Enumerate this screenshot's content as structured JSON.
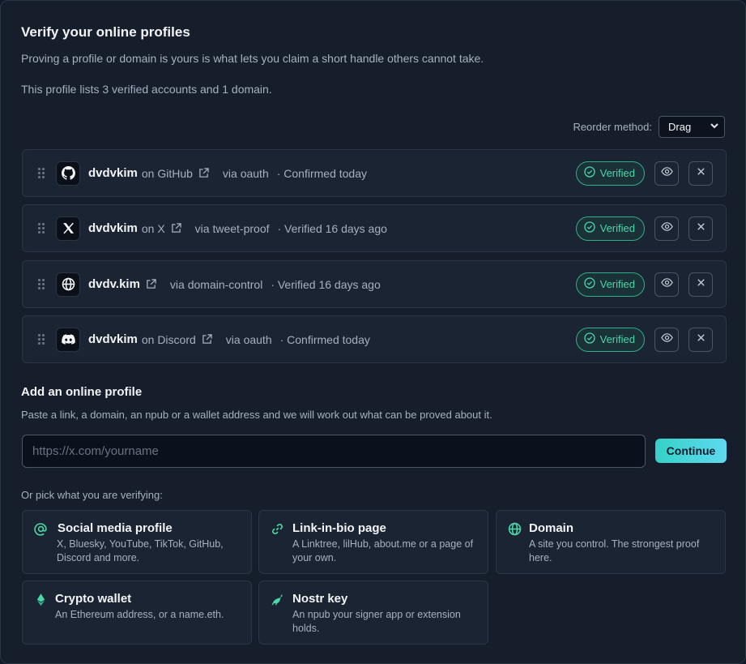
{
  "header": {
    "title": "Verify your online profiles",
    "subtitle": "Proving a profile or domain is yours is what lets you claim a short handle others cannot take.",
    "summary": "This profile lists 3 verified accounts and 1 domain."
  },
  "reorder": {
    "label": "Reorder method:",
    "value": "Drag"
  },
  "profiles": [
    {
      "icon": "github-icon",
      "handle": "dvdvkim",
      "service": "on GitHub",
      "via": "via oauth",
      "confirmed": "· Confirmed today",
      "badge": "Verified"
    },
    {
      "icon": "x-icon",
      "handle": "dvdvkim",
      "service": "on X",
      "via": "via tweet-proof",
      "confirmed": "· Verified 16 days ago",
      "badge": "Verified"
    },
    {
      "icon": "globe-icon",
      "handle": "dvdv.kim",
      "service": "",
      "via": "via domain-control",
      "confirmed": "· Verified 16 days ago",
      "badge": "Verified"
    },
    {
      "icon": "discord-icon",
      "handle": "dvdvkim",
      "service": "on Discord",
      "via": "via oauth",
      "confirmed": "· Confirmed today",
      "badge": "Verified"
    }
  ],
  "add": {
    "title": "Add an online profile",
    "help": "Paste a link, a domain, an npub or a wallet address and we will work out what can be proved about it.",
    "placeholder": "https://x.com/yourname",
    "continue_label": "Continue",
    "pick_label": "Or pick what you are verifying:"
  },
  "options": [
    {
      "icon": "at-icon",
      "title": "Social media profile",
      "desc": "X, Bluesky, YouTube, TikTok, GitHub, Discord and more."
    },
    {
      "icon": "link-icon",
      "title": "Link-in-bio page",
      "desc": "A Linktree, lilHub, about.me or a page of your own."
    },
    {
      "icon": "globe-icon",
      "title": "Domain",
      "desc": "A site you control. The strongest proof here."
    },
    {
      "icon": "ethereum-icon",
      "title": "Crypto wallet",
      "desc": "An Ethereum address, or a name.eth."
    },
    {
      "icon": "ostrich-icon",
      "title": "Nostr key",
      "desc": "An npub your signer app or extension holds."
    }
  ],
  "colors": {
    "accent": "#4ad7a8",
    "button_gradient_start": "#35d2c7",
    "button_gradient_end": "#5fd8f0"
  }
}
